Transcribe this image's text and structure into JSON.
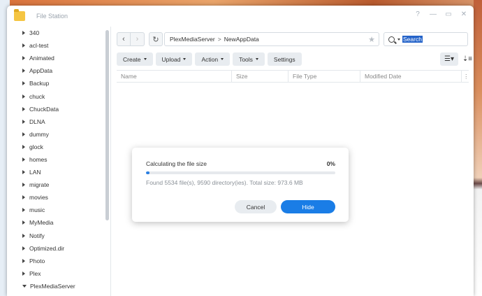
{
  "window": {
    "title": "File Station"
  },
  "sidebar": {
    "items": [
      {
        "label": "340"
      },
      {
        "label": "acl-test"
      },
      {
        "label": "Animated"
      },
      {
        "label": "AppData"
      },
      {
        "label": "Backup"
      },
      {
        "label": "chuck"
      },
      {
        "label": "ChuckData"
      },
      {
        "label": "DLNA"
      },
      {
        "label": "dummy"
      },
      {
        "label": "glock"
      },
      {
        "label": "homes"
      },
      {
        "label": "LAN"
      },
      {
        "label": "migrate"
      },
      {
        "label": "movies"
      },
      {
        "label": "music"
      },
      {
        "label": "MyMedia"
      },
      {
        "label": "Notify"
      },
      {
        "label": "Optimized.dir"
      },
      {
        "label": "Photo"
      },
      {
        "label": "Plex"
      },
      {
        "label": "PlexMediaServer",
        "expanded": true
      }
    ]
  },
  "path": {
    "segments": [
      "PlexMediaServer",
      "NewAppData"
    ],
    "separator": ">"
  },
  "search": {
    "value": "Search"
  },
  "toolbar": {
    "create": "Create",
    "upload": "Upload",
    "action": "Action",
    "tools": "Tools",
    "settings": "Settings"
  },
  "columns": {
    "name": "Name",
    "size": "Size",
    "type": "File Type",
    "modified": "Modified Date"
  },
  "dialog": {
    "title": "Calculating the file size",
    "percent_label": "0%",
    "progress_fraction": 0.02,
    "found": "Found 5534 file(s), 9590 directory(ies). Total size: 973.6 MB",
    "cancel": "Cancel",
    "hide": "Hide"
  },
  "colors": {
    "accent": "#1a7de6",
    "folder": "#f5c542",
    "search_highlight": "#2463c9"
  },
  "icons": [
    "folder-icon",
    "help-icon",
    "minimize-icon",
    "maximize-icon",
    "close-icon",
    "back-icon",
    "forward-icon",
    "refresh-icon",
    "star-icon",
    "search-icon",
    "list-view-icon",
    "sort-icon"
  ]
}
